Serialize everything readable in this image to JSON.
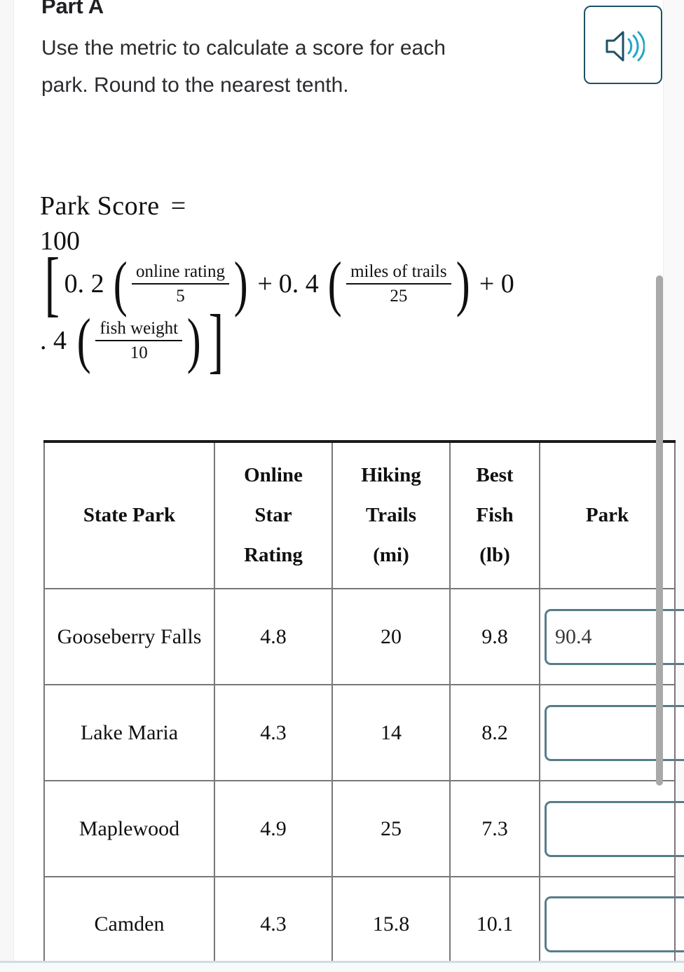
{
  "header": {
    "part_title": "Part A",
    "prompt": "Use the metric to calculate a score for each park. Round to the nearest tenth.",
    "audio_button_name": "play-audio"
  },
  "formula": {
    "label": "Park  Score",
    "equals": "=",
    "leading_coefficient": "100",
    "open_bracket": "[",
    "close_bracket": "]",
    "open_paren": "(",
    "close_paren": ")",
    "term1_coef": "0. 2",
    "term1_num": "online rating",
    "term1_den": "5",
    "plus1": "+",
    "term2_coef": "0. 4",
    "term2_num": "miles of trails",
    "term2_den": "25",
    "plus2": "+ 0",
    "term3_coef": ". 4",
    "term3_num": "fish weight",
    "term3_den": "10"
  },
  "table": {
    "headers": [
      "State Park",
      "Online Star Rating",
      "Hiking Trails (mi)",
      "Best Fish (lb)",
      "Park"
    ],
    "headers_lines": {
      "state_park": [
        "State Park"
      ],
      "online_star_rating": [
        "Online",
        "Star",
        "Rating"
      ],
      "hiking_trails": [
        "Hiking",
        "Trails",
        "(mi)"
      ],
      "best_fish": [
        "Best",
        "Fish",
        "(lb)"
      ],
      "park_score": [
        "Park"
      ]
    },
    "rows": [
      {
        "park": "Gooseberry Falls",
        "rating": "4.8",
        "trails": "20",
        "fish": "9.8",
        "score": "90.4",
        "score_placeholder": ""
      },
      {
        "park": "Lake Maria",
        "rating": "4.3",
        "trails": "14",
        "fish": "8.2",
        "score": "",
        "score_placeholder": ""
      },
      {
        "park": "Maplewood",
        "rating": "4.9",
        "trails": "25",
        "fish": "7.3",
        "score": "",
        "score_placeholder": ""
      },
      {
        "park": "Camden",
        "rating": "4.3",
        "trails": "15.8",
        "fish": "10.1",
        "score": "",
        "score_placeholder": ""
      }
    ]
  },
  "colors": {
    "audio_border": "#1d5264",
    "audio_icon_body": "#1d5264",
    "audio_icon_waves": "#23a6c4",
    "input_border": "#577c89",
    "table_border": "#787878",
    "table_outer_border": "#1a1a1a",
    "scrollbar_thumb": "#a9a9a9",
    "text": "#2a2c2f"
  }
}
